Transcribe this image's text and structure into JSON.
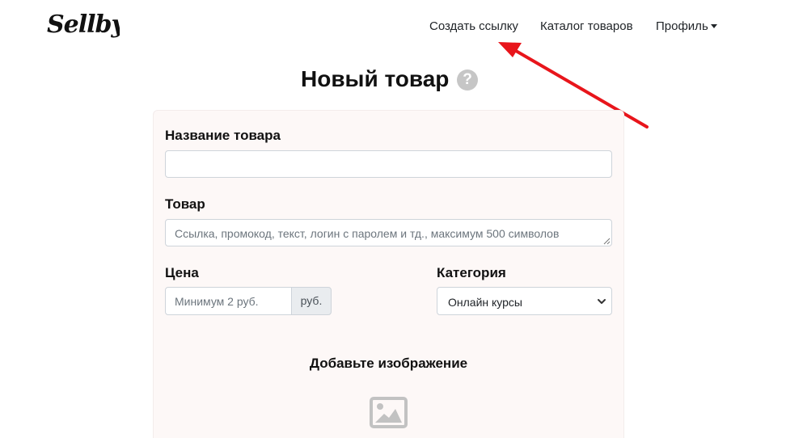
{
  "header": {
    "logo_text": "Sellby",
    "nav": {
      "create_link": "Создать ссылку",
      "catalog": "Каталог товаров",
      "profile": "Профиль"
    }
  },
  "page": {
    "title": "Новый товар",
    "help_icon": "?"
  },
  "form": {
    "name": {
      "label": "Название товара",
      "value": "",
      "placeholder": ""
    },
    "product": {
      "label": "Товар",
      "placeholder": "Ссылка, промокод, текст, логин с паролем и тд., максимум 500 символов"
    },
    "price": {
      "label": "Цена",
      "placeholder": "Минимум 2 руб.",
      "addon": "руб."
    },
    "category": {
      "label": "Категория",
      "selected": "Онлайн курсы"
    },
    "image": {
      "heading": "Добавьте изображение"
    }
  },
  "icons": {
    "help": "question-circle-icon",
    "caret": "caret-down-icon",
    "select_chevron": "chevron-down-icon",
    "image": "image-placeholder-icon",
    "annotation": "red-arrow"
  },
  "colors": {
    "annotation_arrow": "#e8151b",
    "card_background": "#fdf8f7",
    "help_icon": "#c6c6c6"
  }
}
